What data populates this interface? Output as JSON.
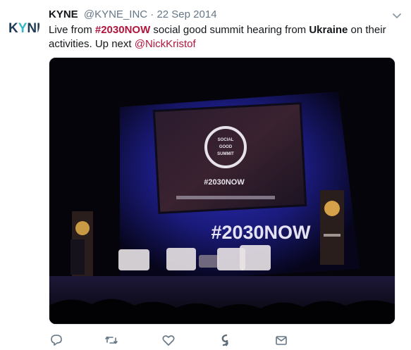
{
  "tweet": {
    "avatar_text": "KYNE",
    "display_name": "KYNE",
    "handle": "@KYNE_INC",
    "separator": "·",
    "date": "22 Sep 2014",
    "text": {
      "part1": "Live from ",
      "hashtag": "#2030NOW",
      "part2": " social good summit hearing from ",
      "bold": "Ukraine",
      "part3": " on their activities. Up next ",
      "mention": "@NickKristof"
    },
    "media": {
      "screen_hashtag": "#2030NOW",
      "stage_hashtag": "#2030NOW",
      "screen_badge_lines": [
        "SOCIAL",
        "GOOD",
        "SUMMIT"
      ]
    },
    "accent_color": "#b0153c",
    "actions": [
      "reply-icon",
      "retweet-icon",
      "like-icon",
      "moments-icon",
      "direct-message-icon"
    ]
  }
}
